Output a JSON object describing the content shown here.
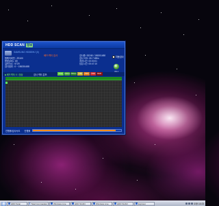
{
  "window": {
    "title": "HDD SCAN",
    "badge": "정보",
    "drive_model": "SAMSUNG HD080HJ (0)",
    "info_lines": [
      "펌웨어버전 : ZS100",
      "용량(GB) : 80",
      "실린더수 : 9729",
      "검사범위 : 0 ~ 156301488"
    ],
    "center_caption": "배드섹터 검사",
    "status_lines": [
      "검사중: 53248 / 156301488",
      "검사 속도: 55.7 MB/s",
      "경과시간: 00:00:01",
      "남은시간: 00:47:10"
    ],
    "auto_check_label": "자동검사",
    "refresh_label": "검사",
    "legend_left": "■ 배드섹터: 0 / 정상",
    "legend_mid": "검사 섹터 분포:",
    "legend_items": [
      {
        "label": "<3ms",
        "color": "#5fcf3a"
      },
      {
        "label": "<10ms",
        "color": "#4aa835"
      },
      {
        "label": "<50ms",
        "color": "#2f7f2a"
      },
      {
        "label": "<150",
        "color": "#c9b02a"
      },
      {
        "label": "<500",
        "color": "#e07b1a"
      },
      {
        "label": ">500",
        "color": "#d02a2a"
      },
      {
        "label": "BAD",
        "color": "#8a0f0f"
      }
    ],
    "bottom_label": "진행률/검사속도",
    "bottom_sub": "진행률",
    "progress_fraction": 0.94
  },
  "taskbar": {
    "start_label": "",
    "tasks": [
      "HDD Scan",
      "Total Commander",
      "Windows Live",
      "HDD SCAN",
      "Windows Live",
      "HDD SCAN",
      "Explorer"
    ],
    "clock": "오후 10:23"
  }
}
